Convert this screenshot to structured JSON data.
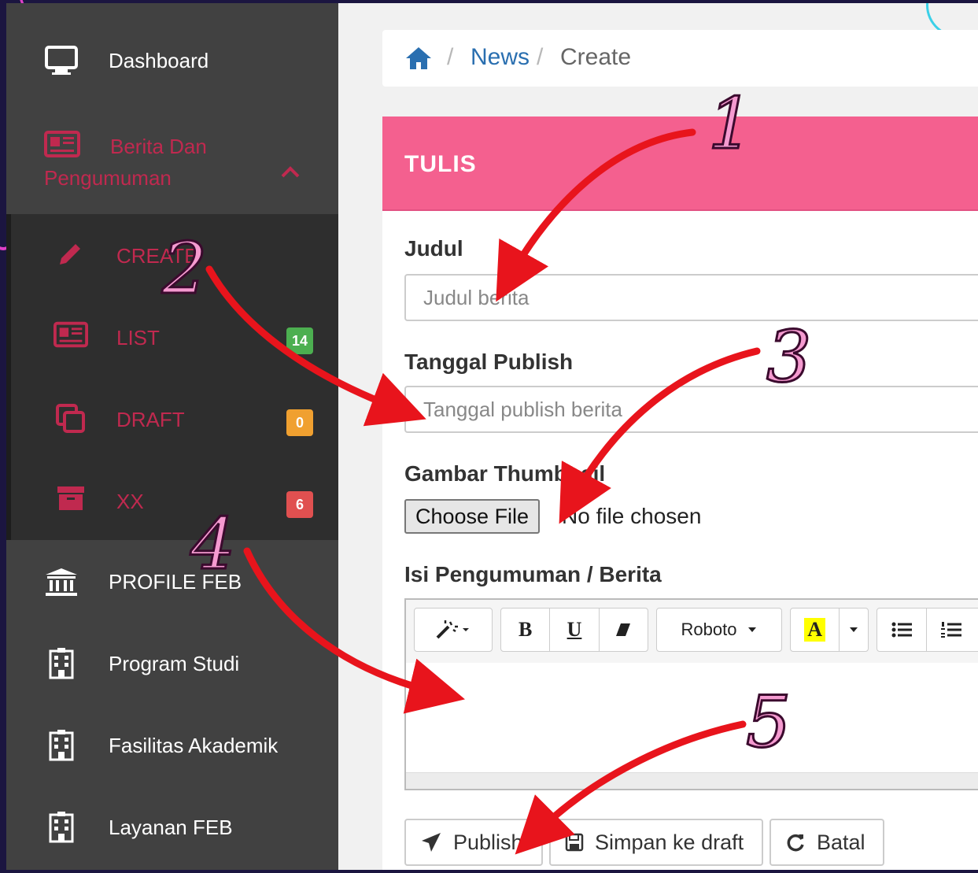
{
  "sidebar": {
    "items": [
      {
        "label": "Dashboard",
        "icon": "monitor-icon"
      },
      {
        "label": "PROFILE FEB",
        "icon": "bank-icon"
      },
      {
        "label": "Program Studi",
        "icon": "building-icon"
      },
      {
        "label": "Fasilitas Akademik",
        "icon": "building-icon"
      },
      {
        "label": "Layanan FEB",
        "icon": "building-icon"
      }
    ],
    "parent": {
      "label": "Berita Dan Pengumuman",
      "icon": "newspaper-icon"
    },
    "submenu": [
      {
        "label": "CREATE",
        "icon": "pencil-icon"
      },
      {
        "label": "LIST",
        "icon": "newspaper-icon",
        "badge": "14",
        "badge_color": "#4caf50"
      },
      {
        "label": "DRAFT",
        "icon": "copy-icon",
        "badge": "0",
        "badge_color": "#f0a030"
      },
      {
        "label": "XX",
        "icon": "archive-icon",
        "badge": "6",
        "badge_color": "#e05050"
      }
    ],
    "accent": "#c0294f"
  },
  "breadcrumb": {
    "items": [
      "News",
      "Create"
    ],
    "separator": "/"
  },
  "card": {
    "title": "TULIS",
    "header_color": "#f4608f"
  },
  "form": {
    "judul": {
      "label": "Judul",
      "placeholder": "Judul berita"
    },
    "tanggal": {
      "label": "Tanggal Publish",
      "placeholder": "Tanggal publish berita"
    },
    "gambar": {
      "label": "Gambar Thumbnail",
      "button": "Choose File",
      "status": "No file chosen"
    },
    "isi": {
      "label": "Isi Pengumuman / Berita"
    }
  },
  "editor": {
    "font": "Roboto",
    "bold": "B",
    "underline": "U",
    "color": "A"
  },
  "actions": {
    "publish": "Publish",
    "draft": "Simpan ke draft",
    "cancel": "Batal"
  },
  "annotations": [
    "1",
    "2",
    "3",
    "4",
    "5"
  ]
}
